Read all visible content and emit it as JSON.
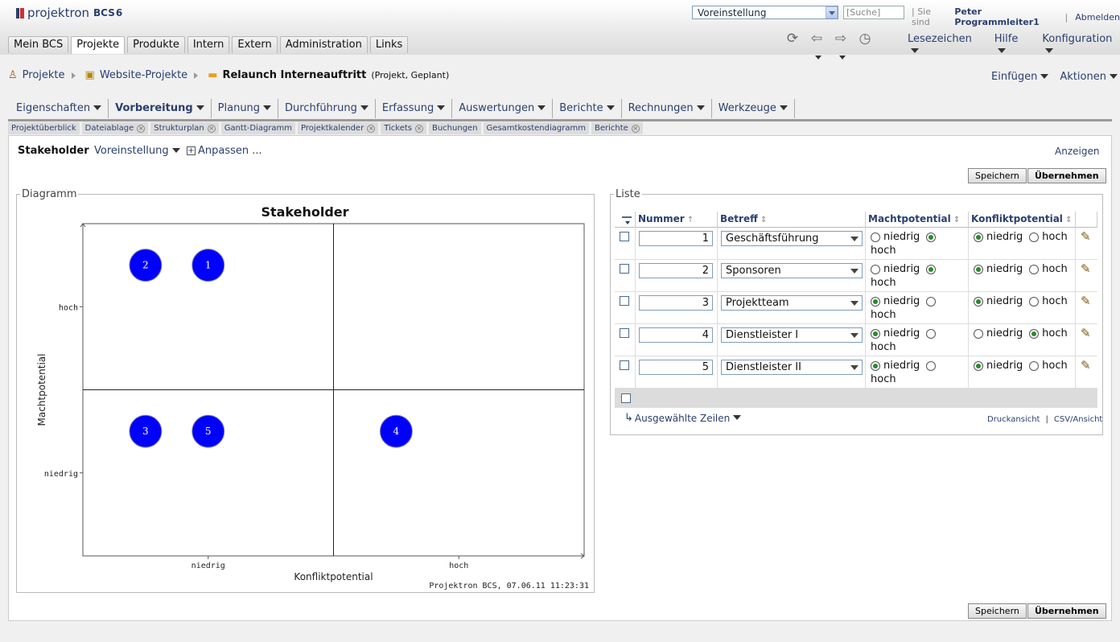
{
  "app": {
    "logo_text": "projektron",
    "logo_bcs": "BCS",
    "logo_ver": "6"
  },
  "top": {
    "view_select": "Voreinstellung",
    "search_placeholder": "[Suche]",
    "sie_sind": "| Sie sind",
    "user": "Peter Programmleiter1",
    "sep": "|",
    "logout": "Abmelden"
  },
  "main_tabs": [
    "Mein BCS",
    "Projekte",
    "Produkte",
    "Intern",
    "Extern",
    "Administration",
    "Links"
  ],
  "toolbar_menus": [
    "Lesezeichen",
    "Hilfe",
    "Konfiguration"
  ],
  "breadcrumb": {
    "items": [
      "Projekte",
      "Website-Projekte"
    ],
    "current": "Relaunch Interneauftritt",
    "current_sub": "(Projekt, Geplant)"
  },
  "bc_actions": [
    "Einfügen",
    "Aktionen"
  ],
  "sub_nav": [
    "Eigenschaften",
    "Vorbereitung",
    "Planung",
    "Durchführung",
    "Erfassung",
    "Auswertungen",
    "Berichte",
    "Rechnungen",
    "Werkzeuge"
  ],
  "quick_tabs": [
    {
      "label": "Projektüberblick",
      "close": false
    },
    {
      "label": "Dateiablage",
      "close": true
    },
    {
      "label": "Strukturplan",
      "close": true
    },
    {
      "label": "Gantt-Diagramm",
      "close": false
    },
    {
      "label": "Projektkalender",
      "close": true
    },
    {
      "label": "Tickets",
      "close": true
    },
    {
      "label": "Buchungen",
      "close": false
    },
    {
      "label": "Gesamtkostendiagramm",
      "close": false
    },
    {
      "label": "Berichte",
      "close": true
    }
  ],
  "page": {
    "title": "Stakeholder",
    "view": "Voreinstellung",
    "customize": "Anpassen ...",
    "show": "Anzeigen"
  },
  "buttons": {
    "save": "Speichern",
    "apply": "Übernehmen"
  },
  "diagram": {
    "legend": "Diagramm",
    "footer": "Projektron BCS, 07.06.11  11:23:31"
  },
  "chart_data": {
    "type": "scatter",
    "title": "Stakeholder",
    "xlabel": "Konfliktpotential",
    "ylabel": "Machtpotential",
    "x_ticks": [
      "niedrig",
      "hoch"
    ],
    "y_ticks": [
      "niedrig",
      "hoch"
    ],
    "points": [
      {
        "label": "1",
        "x": "niedrig",
        "y": "hoch",
        "slot": 2
      },
      {
        "label": "2",
        "x": "niedrig",
        "y": "hoch",
        "slot": 1
      },
      {
        "label": "3",
        "x": "niedrig",
        "y": "niedrig",
        "slot": 1
      },
      {
        "label": "4",
        "x": "hoch",
        "y": "niedrig",
        "slot": 1
      },
      {
        "label": "5",
        "x": "niedrig",
        "y": "niedrig",
        "slot": 2
      }
    ],
    "point_color": "#0000ff"
  },
  "list": {
    "legend": "Liste",
    "columns": [
      "Nummer",
      "Betreff",
      "Machtpotential",
      "Konfliktpotential"
    ],
    "opt_low": "niedrig",
    "opt_high": "hoch",
    "rows": [
      {
        "nr": "1",
        "betreff": "Geschäftsführung",
        "macht": "hoch",
        "konflikt": "niedrig"
      },
      {
        "nr": "2",
        "betreff": "Sponsoren",
        "macht": "hoch",
        "konflikt": "niedrig"
      },
      {
        "nr": "3",
        "betreff": "Projektteam",
        "macht": "niedrig",
        "konflikt": "niedrig"
      },
      {
        "nr": "4",
        "betreff": "Dienstleister I",
        "macht": "niedrig",
        "konflikt": "hoch"
      },
      {
        "nr": "5",
        "betreff": "Dienstleister II",
        "macht": "niedrig",
        "konflikt": "niedrig"
      }
    ],
    "selected_rows": "Ausgewählte Zeilen",
    "print_view": "Druckansicht",
    "csv_view": "CSV/Ansicht"
  }
}
